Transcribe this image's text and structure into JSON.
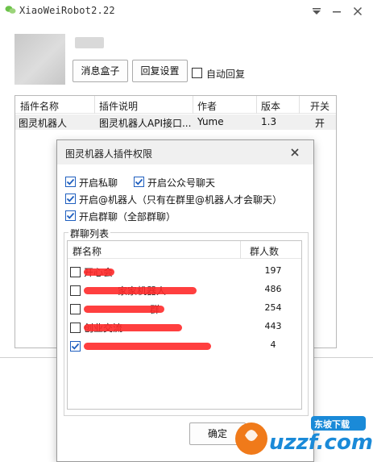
{
  "window": {
    "title": "XiaoWeiRobot2.22",
    "nickname": "...",
    "buttons": {
      "message_box": "消息盒子",
      "reply_settings": "回复设置"
    },
    "auto_reply": {
      "label": "自动回复",
      "checked": false
    }
  },
  "plugin_table": {
    "columns": [
      "插件名称",
      "插件说明",
      "作者",
      "版本",
      "开关"
    ],
    "rows": [
      {
        "name": "图灵机器人",
        "description": "图灵机器人API接口...",
        "author": "Yume",
        "version": "1.3",
        "switch": "开"
      }
    ]
  },
  "dialog": {
    "title": "图灵机器人插件权限",
    "options": [
      {
        "label": "开启私聊",
        "checked": true
      },
      {
        "label": "开启公众号聊天",
        "checked": true
      },
      {
        "label": "开启@机器人（只有在群里@机器人才会聊天）",
        "checked": true
      },
      {
        "label": "开启群聊（全部群聊）",
        "checked": true
      }
    ],
    "group_box_title": "群聊列表",
    "group_columns": [
      "群名称",
      "群人数"
    ],
    "groups": [
      {
        "name": "开心会",
        "count": "197",
        "checked": false
      },
      {
        "name": "家家机器人",
        "count": "486",
        "checked": false
      },
      {
        "name": "群",
        "count": "254",
        "checked": false
      },
      {
        "name": "创业交流",
        "count": "443",
        "checked": false
      },
      {
        "name": "",
        "count": "4",
        "checked": true
      }
    ],
    "ok_label": "确定"
  },
  "watermark": {
    "text": "uzzf.com",
    "badge": "东坡下载"
  },
  "colors": {
    "accent": "#1f5fbf",
    "redaction": "#ff2a2a",
    "watermark_orange": "#f07a1a",
    "watermark_blue": "#1a8ad8"
  }
}
